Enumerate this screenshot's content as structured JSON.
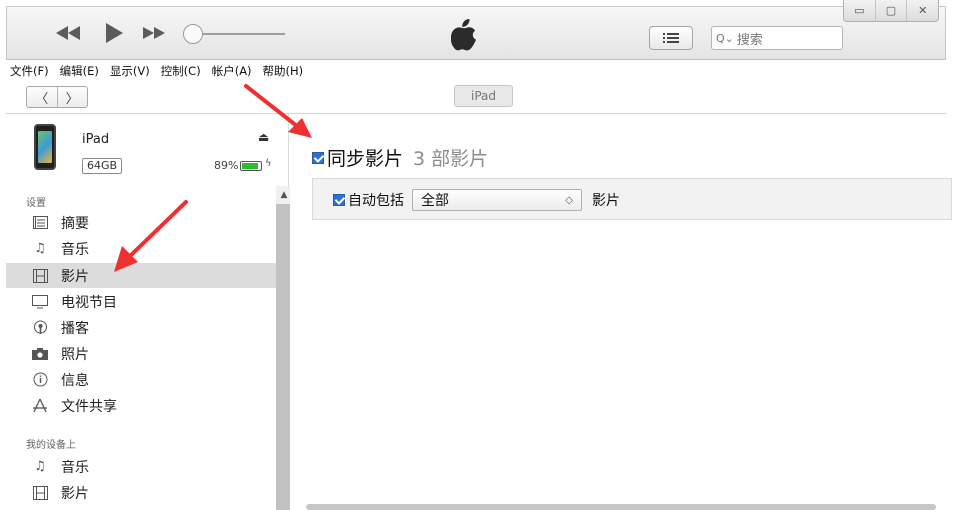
{
  "toolbar": {
    "search_placeholder": "搜索",
    "window_controls": [
      "▭",
      "▢",
      "✕"
    ]
  },
  "menu": {
    "items": [
      "文件(F)",
      "编辑(E)",
      "显示(V)",
      "控制(C)",
      "帐户(A)",
      "帮助(H)"
    ]
  },
  "nav": {
    "back_glyph": "〈",
    "forward_glyph": "〉",
    "device_tab_label": "iPad"
  },
  "device": {
    "name": "iPad",
    "capacity": "64GB",
    "battery_percent": "89%",
    "battery_level": 0.89,
    "eject_glyph": "⏏",
    "bolt_glyph": "ϟ"
  },
  "sidebar": {
    "settings_label": "设置",
    "settings_items": [
      {
        "label": "摘要",
        "icon": "summary-icon"
      },
      {
        "label": "音乐",
        "icon": "music-note-icon"
      },
      {
        "label": "影片",
        "icon": "film-icon"
      },
      {
        "label": "电视节目",
        "icon": "tv-icon"
      },
      {
        "label": "播客",
        "icon": "podcast-icon"
      },
      {
        "label": "照片",
        "icon": "camera-icon"
      },
      {
        "label": "信息",
        "icon": "info-icon"
      },
      {
        "label": "文件共享",
        "icon": "app-store-icon"
      }
    ],
    "my_device_label": "我的设备上",
    "my_device_items": [
      {
        "label": "音乐",
        "icon": "music-note-icon"
      },
      {
        "label": "影片",
        "icon": "film-icon"
      }
    ],
    "selected_item": "影片"
  },
  "main": {
    "sync_label": "同步影片",
    "sync_count": "3 部影片",
    "auto_include_label": "自动包括",
    "auto_include_value": "全部",
    "auto_include_suffix": "影片"
  },
  "colors": {
    "arrow": "#ee3030",
    "checkbox": "#2f6fd6",
    "battery": "#2fbb2f",
    "selected_row": "#dcdcdc"
  }
}
